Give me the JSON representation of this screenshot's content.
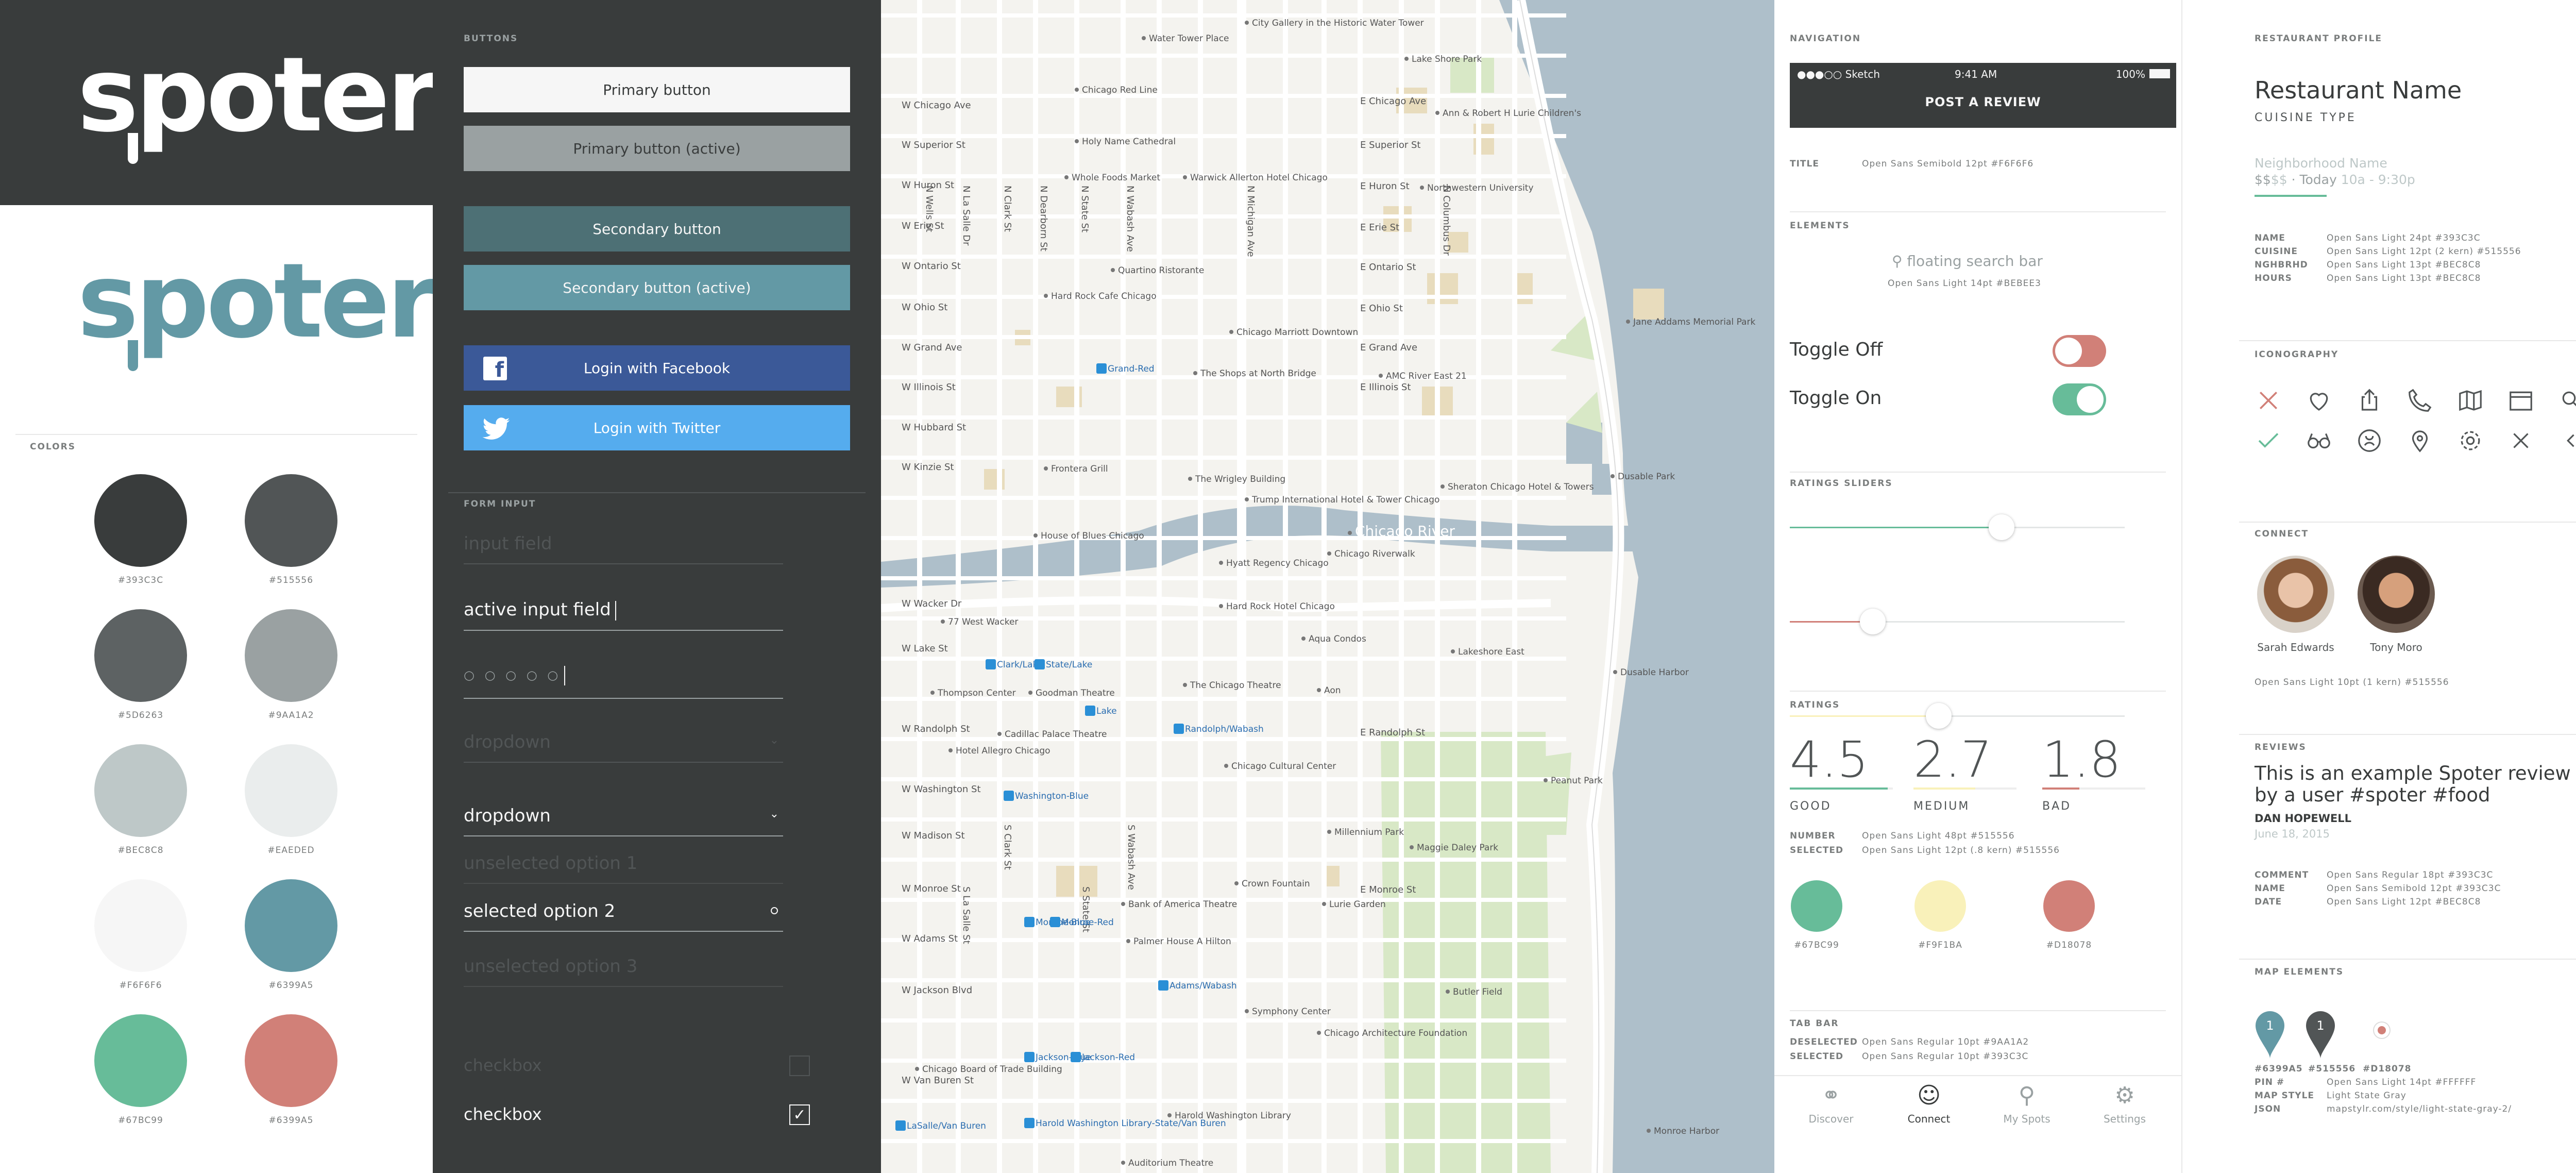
{
  "brand": {
    "logo": "spoter",
    "colors": {
      "dark": "#393C3C",
      "dark2": "#515556",
      "gray1": "#5D6263",
      "gray2": "#9AA1A2",
      "gray3": "#BEC8C8",
      "gray4": "#EAEDED",
      "light": "#F6F6F6",
      "teal": "#6399A5",
      "green": "#67BC99",
      "red": "#D18078",
      "blue": "#3b5998",
      "twitter": "#55acee"
    }
  },
  "colors_section": {
    "title": "COLORS",
    "swatches": [
      {
        "label": "#393C3C",
        "color": "#393C3C"
      },
      {
        "label": "#515556",
        "color": "#515556"
      },
      {
        "label": "#5D6263",
        "color": "#5D6263"
      },
      {
        "label": "#9AA1A2",
        "color": "#9AA1A2"
      },
      {
        "label": "#BEC8C8",
        "color": "#BEC8C8"
      },
      {
        "label": "#EAEDED",
        "color": "#EAEDED"
      },
      {
        "label": "#F6F6F6",
        "color": "#F6F6F6"
      },
      {
        "label": "#6399A5",
        "color": "#6399A5"
      },
      {
        "label": "#67BC99",
        "color": "#67BC99"
      },
      {
        "label": "#6399A5",
        "color": "#D18078"
      }
    ]
  },
  "buttons": {
    "title": "BUTTONS",
    "primary": "Primary button",
    "primary_active": "Primary button (active)",
    "secondary": "Secondary button",
    "secondary_active": "Secondary button (active)",
    "facebook": "Login with Facebook",
    "twitter": "Login with Twitter"
  },
  "form": {
    "title": "FORM INPUT",
    "input_placeholder": "input field",
    "input_active": "active input field",
    "password": "○ ○ ○ ○ ○",
    "dropdown_placeholder": "dropdown",
    "dropdown_active": "dropdown",
    "option1": "unselected option 1",
    "option2": "selected option 2",
    "option3": "unselected option 3",
    "checkbox_off": "checkbox",
    "checkbox_on": "checkbox"
  },
  "map": {
    "streets_ns": [
      "N Wells St",
      "N La Salle Dr",
      "N Clark St",
      "N Dearborn St",
      "N State St",
      "N Wabash Ave",
      "N Michigan Ave",
      "N Columbus Dr",
      "S Wabash Ave",
      "S State St",
      "S Clark St",
      "S La Salle St"
    ],
    "streets_ew": [
      "W Chicago Ave",
      "W Superior St",
      "W Huron St",
      "W Erie St",
      "W Ontario St",
      "W Ohio St",
      "W Grand Ave",
      "W Illinois St",
      "W Hubbard St",
      "W Kinzie St",
      "W Wacker Dr",
      "W Lake St",
      "W Randolph St",
      "W Washington St",
      "W Madison St",
      "W Monroe St",
      "W Adams St",
      "W Jackson Blvd",
      "W Van Buren St",
      "E Chicago Ave",
      "E Superior St",
      "E Huron St",
      "E Erie St",
      "E Ontario St",
      "E Ohio St",
      "E Grand Ave",
      "E Illinois St",
      "E Randolph St",
      "E Monroe St"
    ],
    "pois": [
      "Water Tower Place",
      "Lake Shore Park",
      "City Gallery in the Historic Water Tower",
      "Chicago Red Line",
      "Holy Name Cathedral",
      "Ann & Robert H Lurie Children's",
      "Whole Foods Market",
      "Warwick Allerton Hotel Chicago",
      "Northwestern University",
      "Hard Rock Cafe Chicago",
      "Quartino Ristorante",
      "Chicago Marriott Downtown",
      "The Shops at North Bridge",
      "AMC River East 21",
      "Frontera Grill",
      "The Wrigley Building",
      "Trump International Hotel & Tower Chicago",
      "Sheraton Chicago Hotel & Towers",
      "House of Blues Chicago",
      "Chicago River",
      "Hyatt Regency Chicago",
      "Chicago Riverwalk",
      "77 West Wacker",
      "Hard Rock Hotel Chicago",
      "Aqua Condos",
      "Lakeshore East",
      "Aon",
      "The Chicago Theatre",
      "Goodman Theatre",
      "Thompson Center",
      "Cadillac Palace Theatre",
      "Hotel Allegro Chicago",
      "Chicago Cultural Center",
      "Millennium Park",
      "Maggie Daley Park",
      "Crown Fountain",
      "Lurie Garden",
      "Bank of America Theatre",
      "Palmer House A Hilton",
      "Butler Field",
      "Symphony Center",
      "Chicago Architecture Foundation",
      "Chicago Board of Trade Building",
      "Harold Washington Library",
      "Auditorium Theatre",
      "Peanut Park",
      "Jane Addams Memorial Park",
      "Dusable Park",
      "Dusable Harbor",
      "Monroe Harbor",
      "Grand-Red",
      "Lake",
      "Clark/Lake",
      "State/Lake",
      "Randolph/Wabash",
      "Washington-Blue",
      "Monroe-Blue",
      "Monroe-Red",
      "Adams/Wabash",
      "Jackson-Blue",
      "Jackson-Red",
      "LaSalle/Van Buren",
      "Harold Washington Library-State/Van Buren"
    ]
  },
  "navigation": {
    "title": "NAVIGATION",
    "status_carrier": "●●●○○ Sketch",
    "status_time": "9:41 AM",
    "status_battery": "100%",
    "nav_title": "POST A REVIEW",
    "title_label": "TITLE",
    "title_spec": "Open Sans Semibold 12pt #F6F6F6"
  },
  "elements": {
    "title": "ELEMENTS",
    "search_placeholder": "floating search bar",
    "search_spec": "Open Sans Light 14pt #BEBEE3",
    "toggle_off": "Toggle Off",
    "toggle_on": "Toggle On"
  },
  "sliders": {
    "title": "RATINGS SLIDERS",
    "values": [
      0.64,
      0.25,
      0.45
    ]
  },
  "ratings": {
    "title": "RATINGS",
    "items": [
      {
        "value": "4.5",
        "label": "GOOD",
        "color": "#67BC99"
      },
      {
        "value": "2.7",
        "label": "MEDIUM",
        "color": "#F9F1BA"
      },
      {
        "value": "1.8",
        "label": "BAD",
        "color": "#D18078"
      }
    ],
    "number_label": "NUMBER",
    "number_spec": "Open Sans Light 48pt #515556",
    "selected_label": "SELECTED",
    "selected_spec": "Open Sans Light 12pt (.8 kern) #515556",
    "swatches": [
      {
        "label": "#67BC99",
        "color": "#67BC99"
      },
      {
        "label": "#F9F1BA",
        "color": "#F9F1BA"
      },
      {
        "label": "#D18078",
        "color": "#D18078"
      }
    ]
  },
  "tabbar": {
    "title": "TAB BAR",
    "deselected_label": "DESELECTED",
    "deselected_spec": "Open Sans Regular 10pt #9AA1A2",
    "selected_label": "SELECTED",
    "selected_spec": "Open Sans Regular 10pt #393C3C",
    "tabs": [
      {
        "label": "Discover"
      },
      {
        "label": "Connect"
      },
      {
        "label": "My Spots"
      },
      {
        "label": "Settings"
      }
    ]
  },
  "profile": {
    "title": "RESTAURANT PROFILE",
    "name": "Restaurant Name",
    "cuisine": "CUISINE TYPE",
    "neighborhood": "Neighborhood Name",
    "price": "$$",
    "price_dim": "$$",
    "today": "· Today",
    "hours": "10a - 9:30p",
    "specs": [
      {
        "k": "NAME",
        "v": "Open Sans Light 24pt #393C3C"
      },
      {
        "k": "CUISINE",
        "v": "Open Sans Light 12pt (2 kern) #515556"
      },
      {
        "k": "NGHBRHD",
        "v": "Open Sans Light 13pt #BEC8C8"
      },
      {
        "k": "HOURS",
        "v": "Open Sans Light 13pt #BEC8C8"
      }
    ]
  },
  "iconography": {
    "title": "ICONOGRAPHY"
  },
  "connect": {
    "title": "CONNECT",
    "people": [
      {
        "name": "Sarah Edwards"
      },
      {
        "name": "Tony Moro"
      }
    ],
    "spec": "Open Sans Light 10pt (1 kern) #515556"
  },
  "reviews": {
    "title": "REVIEWS",
    "text": "This is an example Spoter review left by a user #spoter #food",
    "author": "DAN HOPEWELL",
    "date": "June 18, 2015",
    "specs": [
      {
        "k": "COMMENT",
        "v": "Open Sans Regular 18pt #393C3C"
      },
      {
        "k": "NAME",
        "v": "Open Sans Semibold 12pt #393C3C"
      },
      {
        "k": "DATE",
        "v": "Open Sans Light 12pt #BEC8C8"
      }
    ]
  },
  "map_elements": {
    "title": "MAP ELEMENTS",
    "pins": [
      {
        "label": "#6399A5",
        "num": "1"
      },
      {
        "label": "#515556",
        "num": "1"
      },
      {
        "label": "#D18078"
      }
    ],
    "specs": [
      {
        "k": "PIN #",
        "v": "Open Sans Light 14pt #FFFFFF"
      },
      {
        "k": "MAP STYLE",
        "v": "Light State Gray"
      },
      {
        "k": "JSON",
        "v": "mapstylr.com/style/light-state-gray-2/"
      }
    ]
  }
}
